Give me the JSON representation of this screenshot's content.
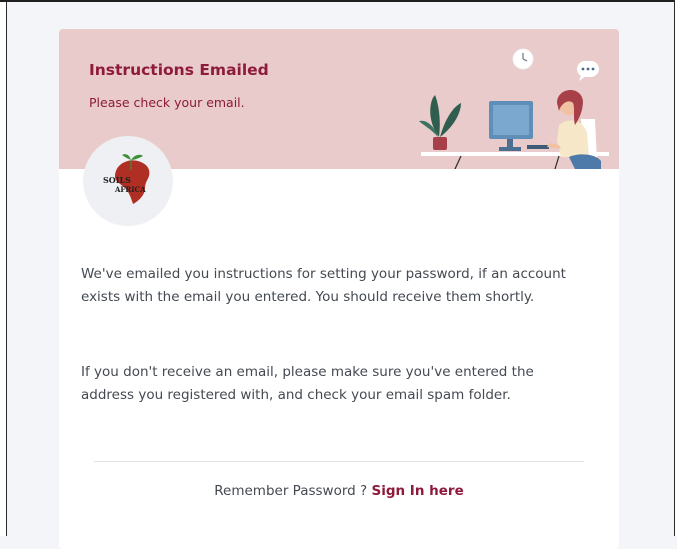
{
  "header": {
    "title": "Instructions Emailed",
    "subtitle": "Please check your email."
  },
  "logo": {
    "text_line1": "SOILS",
    "text_line2": "AFRICA"
  },
  "body": {
    "paragraph1": "We've emailed you instructions for setting your password, if an account exists with the email you entered. You should receive them shortly.",
    "paragraph2": "If you don't receive an email, please make sure you've entered the address you registered with, and check your email spam folder."
  },
  "footer": {
    "prompt": "Remember Password ?",
    "link_label": "Sign In here"
  },
  "colors": {
    "accent": "#8e1a3c",
    "header_bg": "#e8cbca",
    "page_bg": "#f4f5f8",
    "text": "#444a52"
  }
}
